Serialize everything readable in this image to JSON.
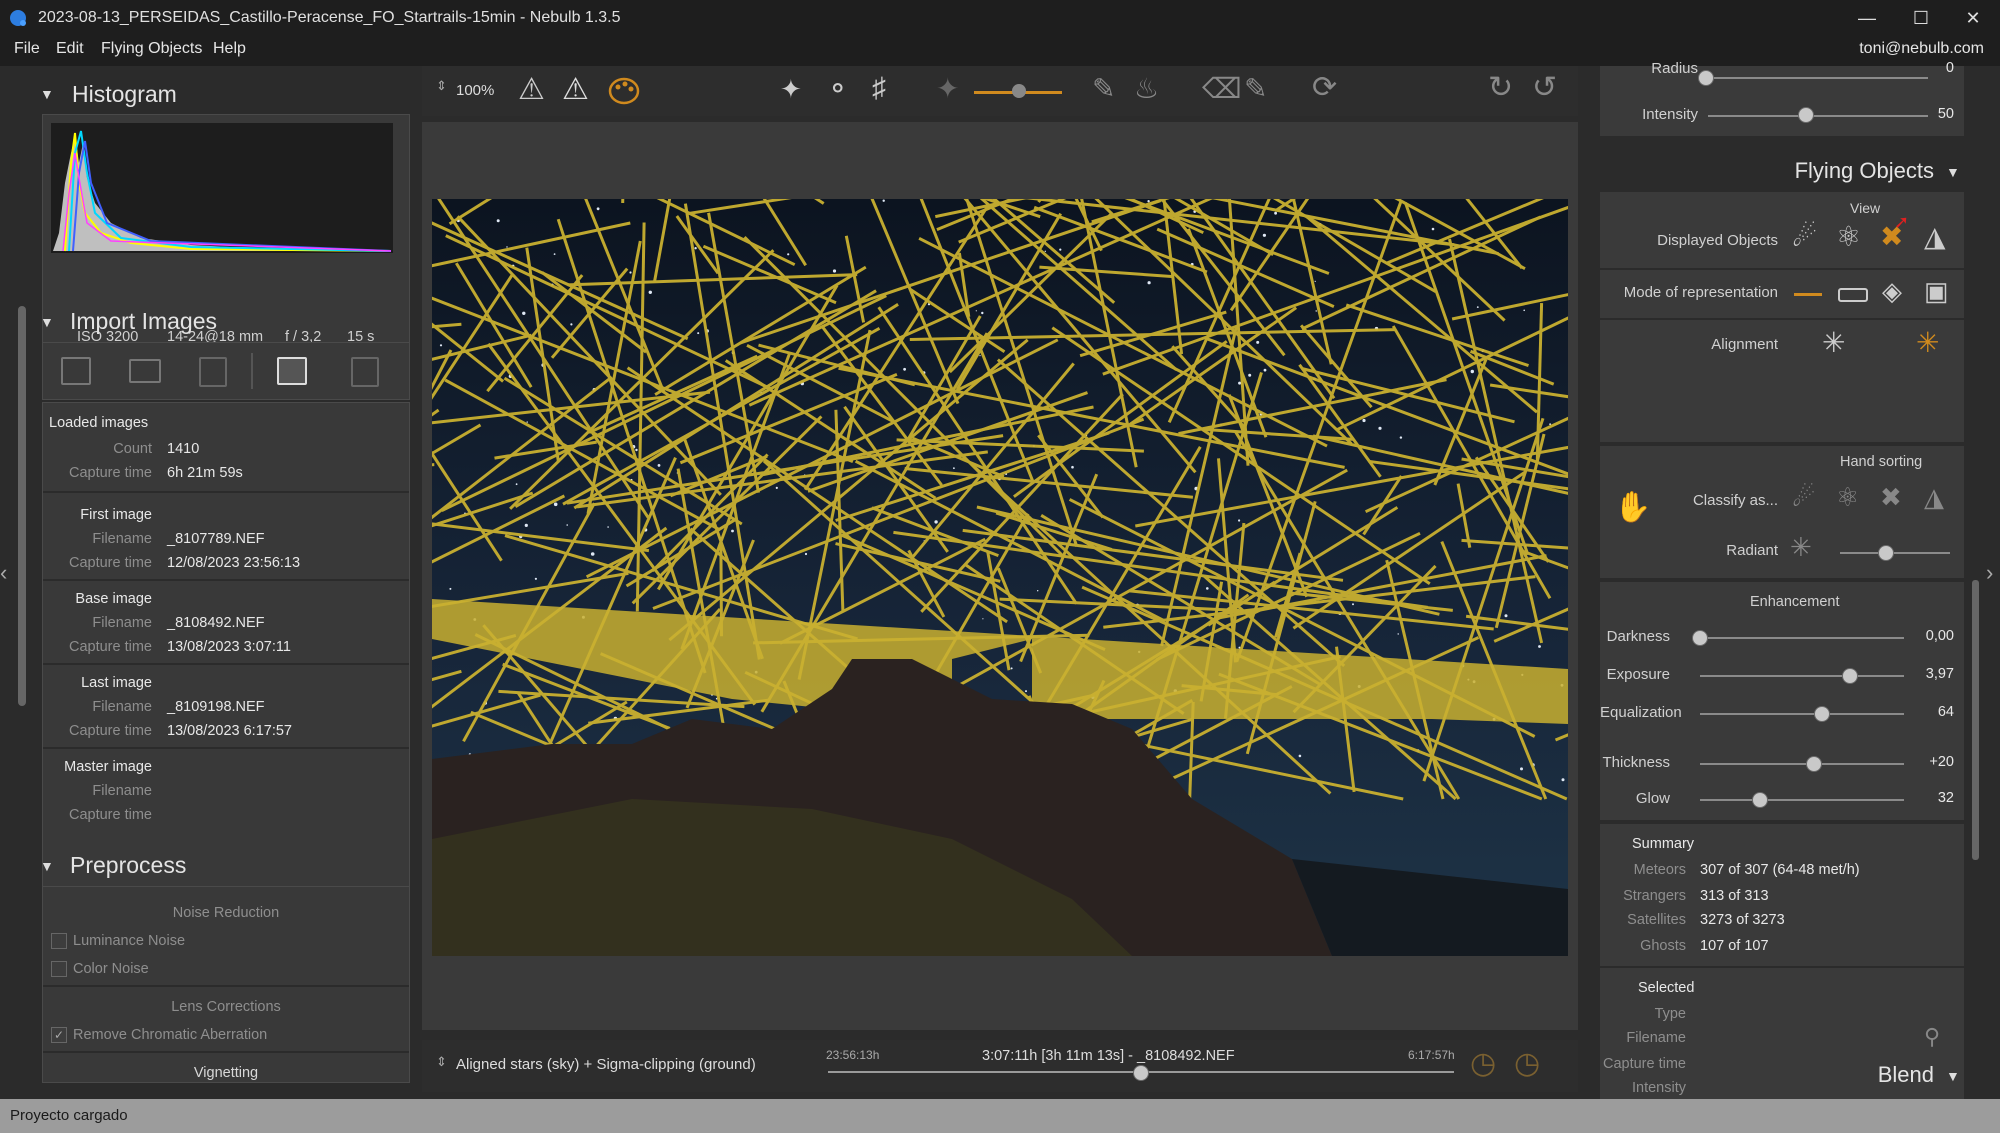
{
  "window": {
    "title": "2023-08-13_PERSEIDAS_Castillo-Peracense_FO_Startrails-15min - Nebulb 1.3.5"
  },
  "menu": {
    "items": [
      "File",
      "Edit",
      "Flying Objects",
      "Help"
    ],
    "user": "toni@nebulb.com"
  },
  "histogram": {
    "title": "Histogram",
    "iso": "ISO 3200",
    "lens": "14-24@18 mm",
    "aperture": "f / 3,2",
    "exposure": "15 s"
  },
  "import": {
    "title": "Import Images",
    "loaded_label": "Loaded images",
    "count_label": "Count",
    "count": "1410",
    "capture_label": "Capture time",
    "capture": "6h 21m 59s",
    "filename_label": "Filename",
    "first_label": "First image",
    "first_file": "_8107789.NEF",
    "first_time": "12/08/2023 23:56:13",
    "base_label": "Base image",
    "base_file": "_8108492.NEF",
    "base_time": "13/08/2023 3:07:11",
    "last_label": "Last image",
    "last_file": "_8109198.NEF",
    "last_time": "13/08/2023 6:17:57",
    "master_label": "Master image"
  },
  "preprocess": {
    "title": "Preprocess",
    "noise_reduction": "Noise Reduction",
    "luminance_noise": "Luminance Noise",
    "color_noise": "Color Noise",
    "lens_corrections": "Lens Corrections",
    "remove_ca": "Remove Chromatic Aberration",
    "vignetting": "Vignetting"
  },
  "toolbar": {
    "zoom": "100%"
  },
  "timeline": {
    "mode": "Aligned stars (sky) + Sigma-clipping (ground)",
    "start": "23:56:13h",
    "center": "3:07:11h [3h 11m 13s] - _8108492.NEF",
    "end": "6:17:57h",
    "position": 0.5
  },
  "right": {
    "radius_label": "Radius",
    "radius_value": "0",
    "intensity_label": "Intensity",
    "intensity_value": "50",
    "flying_title": "Flying Objects",
    "view": "View",
    "displayed_objects": "Displayed Objects",
    "mode_repr": "Mode of representation",
    "alignment": "Alignment",
    "hand_sorting": "Hand sorting",
    "classify": "Classify as...",
    "radiant": "Radiant",
    "enhancement": "Enhancement",
    "darkness_label": "Darkness",
    "darkness": "0,00",
    "exposure_label": "Exposure",
    "exposure": "3,97",
    "equalization_label": "Equalization",
    "equalization": "64",
    "thickness_label": "Thickness",
    "thickness": "+20",
    "glow_label": "Glow",
    "glow": "32",
    "summary": "Summary",
    "meteors_label": "Meteors",
    "meteors": "307 of 307 (64-48 met/h)",
    "strangers_label": "Strangers",
    "strangers": "313 of 313",
    "satellites_label": "Satellites",
    "satellites": "3273 of 3273",
    "ghosts_label": "Ghosts",
    "ghosts": "107 of 107",
    "selected": "Selected",
    "type_label": "Type",
    "filename_label": "Filename",
    "capture_label": "Capture time",
    "intensity2_label": "Intensity",
    "blend": "Blend"
  },
  "status": {
    "text": "Proyecto cargado"
  },
  "colors": {
    "accent": "#d08a1e",
    "trail": "#c9b030",
    "panel": "#3a3a3a"
  }
}
